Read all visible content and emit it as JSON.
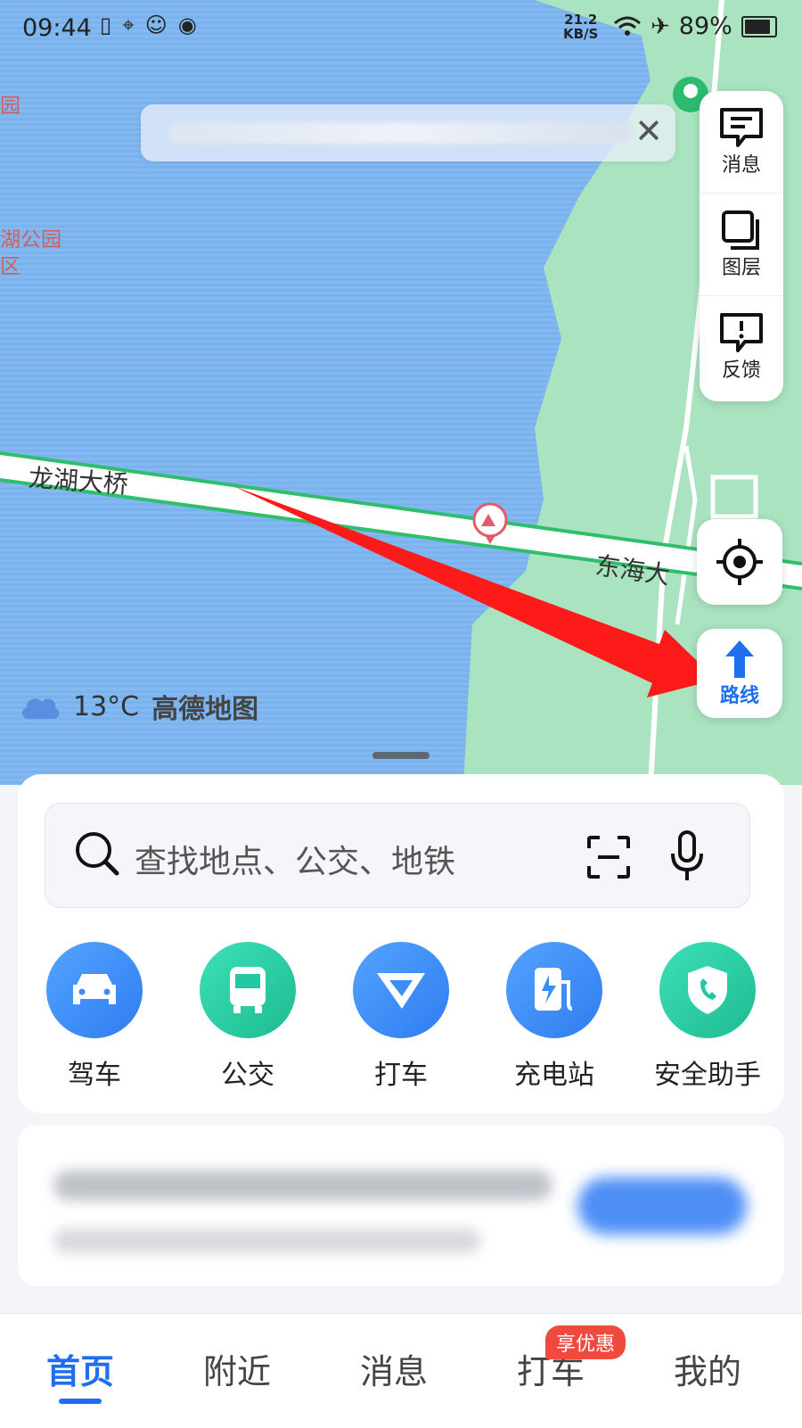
{
  "status_bar": {
    "time": "09:44",
    "speed_value": "21.2",
    "speed_unit": "KB/S",
    "battery": "89%"
  },
  "map": {
    "bridge_label": "龙湖大桥",
    "road_label": "东海大",
    "park_label_line1": "湖公园",
    "park_label_line2": "区",
    "park_corner_label": "园",
    "temperature": "13°C",
    "brand": "高德地图"
  },
  "side_panel": {
    "message": "消息",
    "layers": "图层",
    "feedback": "反馈"
  },
  "route_button": {
    "label": "路线"
  },
  "search": {
    "placeholder": "查找地点、公交、地铁"
  },
  "quick_actions": [
    {
      "label": "驾车",
      "icon": "car-icon",
      "color": "#3b8ef5"
    },
    {
      "label": "公交",
      "icon": "bus-icon",
      "color": "#22c7a3"
    },
    {
      "label": "打车",
      "icon": "taxi-icon",
      "color": "#3b8ef5"
    },
    {
      "label": "充电站",
      "icon": "charging-station-icon",
      "color": "#3b8ef5"
    },
    {
      "label": "安全助手",
      "icon": "safety-shield-icon",
      "color": "#22c7a3"
    }
  ],
  "tabbar": {
    "home": "首页",
    "nearby": "附近",
    "messages": "消息",
    "taxi": "打车",
    "mine": "我的",
    "taxi_badge": "享优惠"
  },
  "colors": {
    "accent": "#1e6ff0",
    "water": "#7ab2ee",
    "park": "#a8e2bd",
    "arrow": "#ff1a1a"
  }
}
